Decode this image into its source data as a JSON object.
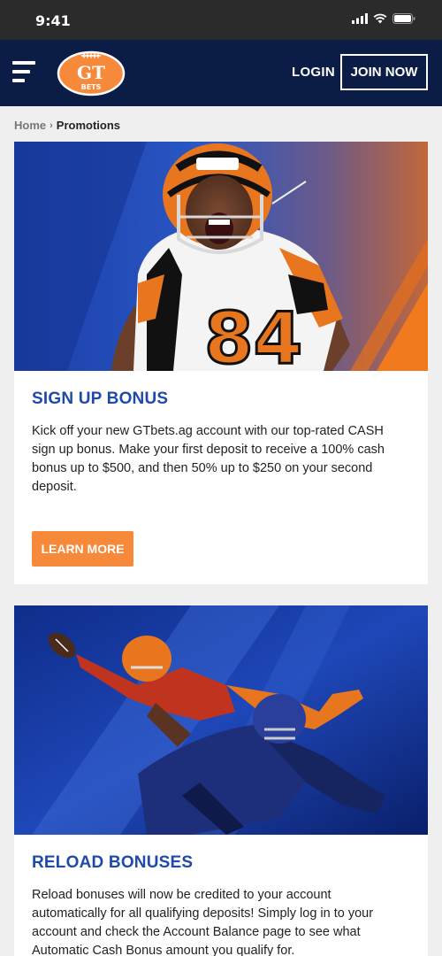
{
  "status_bar": {
    "time": "9:41"
  },
  "header": {
    "logo_text_top": "GT",
    "logo_text_bottom": "BETS",
    "login_label": "LOGIN",
    "join_label": "JOIN NOW"
  },
  "breadcrumb": {
    "home": "Home",
    "separator": "›",
    "current": "Promotions"
  },
  "promotions": [
    {
      "title": "SIGN UP BONUS",
      "description": "Kick off your new GTbets.ag account with our top-rated CASH sign up bonus. Make your first deposit to receive a 100% cash bonus up to $500, and then 50% up to $250 on your second deposit.",
      "cta": "LEARN MORE",
      "jersey_number": "84"
    },
    {
      "title": "RELOAD BONUSES",
      "description": "Reload bonuses will now be credited to your account automatically for all qualifying deposits! Simply log in to your account and check the Account Balance page to see what Automatic Cash Bonus amount you qualify for."
    }
  ],
  "colors": {
    "header_bg": "#0b1c47",
    "accent_orange": "#f7893a",
    "title_blue": "#1f4aa8"
  }
}
